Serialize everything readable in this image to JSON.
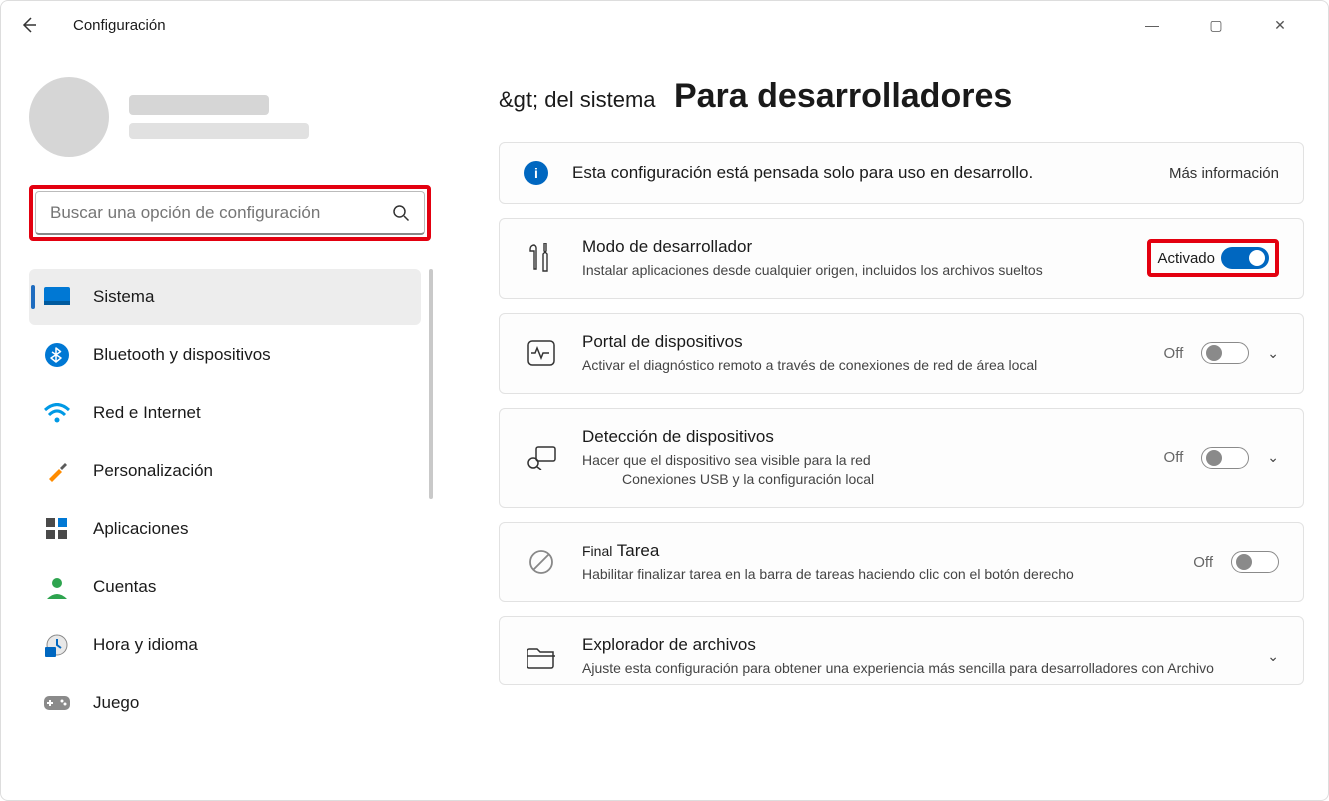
{
  "app_title": "Configuración",
  "window_controls": {
    "min": "min",
    "max": "max",
    "close": "close"
  },
  "search": {
    "placeholder": "Buscar una opción de configuración"
  },
  "sidebar": {
    "items": [
      {
        "label": "Sistema",
        "icon": "system",
        "active": true
      },
      {
        "label": "Bluetooth y dispositivos",
        "icon": "bluetooth"
      },
      {
        "label": "Red e Internet",
        "icon": "wifi"
      },
      {
        "label": "Personalización",
        "icon": "brush"
      },
      {
        "label": "Aplicaciones",
        "icon": "apps"
      },
      {
        "label": "Cuentas",
        "icon": "account"
      },
      {
        "label": "Hora y idioma",
        "icon": "clock"
      },
      {
        "label": "Juego",
        "icon": "game"
      }
    ]
  },
  "header": {
    "breadcrumb": "&gt; del sistema",
    "title": "Para desarrolladores"
  },
  "info_banner": {
    "text": "Esta configuración está pensada solo para uso en desarrollo.",
    "link": "Más información"
  },
  "cards": {
    "dev_mode": {
      "title": "Modo de desarrollador",
      "desc": "Instalar aplicaciones desde cualquier origen, incluidos los archivos sueltos",
      "state_label": "Activado",
      "toggle": "on"
    },
    "device_portal": {
      "title": "Portal de dispositivos",
      "desc": "Activar el diagnóstico remoto a través de conexiones de red de área local",
      "state_label": "Off",
      "toggle": "off",
      "expandable": true
    },
    "device_discovery": {
      "title": "Detección de dispositivos",
      "desc_a": "Hacer que el dispositivo sea visible para la red",
      "desc_b": "Conexiones USB y la configuración local",
      "state_label": "Off",
      "toggle": "off",
      "expandable": true
    },
    "end_task": {
      "title_a": "Final",
      "title_b": "Tarea",
      "desc": "Habilitar finalizar tarea en la barra de tareas haciendo clic con el botón derecho",
      "state_label": "Off",
      "toggle": "off"
    },
    "file_explorer": {
      "title": "Explorador de archivos",
      "desc": "Ajuste esta configuración para obtener una experiencia más sencilla para desarrolladores con Archivo"
    }
  }
}
